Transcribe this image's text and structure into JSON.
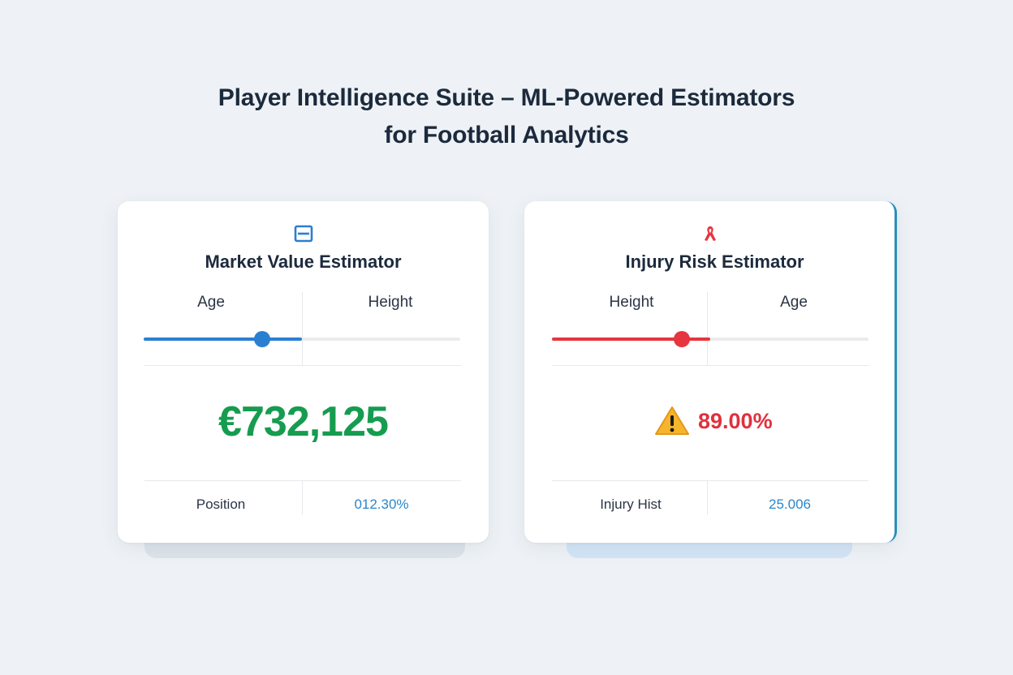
{
  "header": {
    "title_line1": "Player Intelligence Suite – ML-Powered Estimators",
    "title_line2": "for Football Analytics"
  },
  "market_card": {
    "icon": "card-icon",
    "title": "Market Value Estimator",
    "slider_labels": [
      "Age",
      "Height"
    ],
    "slider_fraction": 0.375,
    "accent_color": "#2b7fd1",
    "value": "€732,125",
    "value_color": "#169c50",
    "footer_label": "Position",
    "footer_value": "012.30%"
  },
  "injury_card": {
    "icon": "ribbon-icon",
    "title": "Injury Risk Estimator",
    "slider_labels": [
      "Height",
      "Age"
    ],
    "slider_fraction": 0.41,
    "accent_color": "#e6353f",
    "warning_icon": "warning-icon",
    "value": "89.00%",
    "value_color": "#e0313d",
    "footer_label": "Injury Hist",
    "footer_value": "25.006"
  }
}
